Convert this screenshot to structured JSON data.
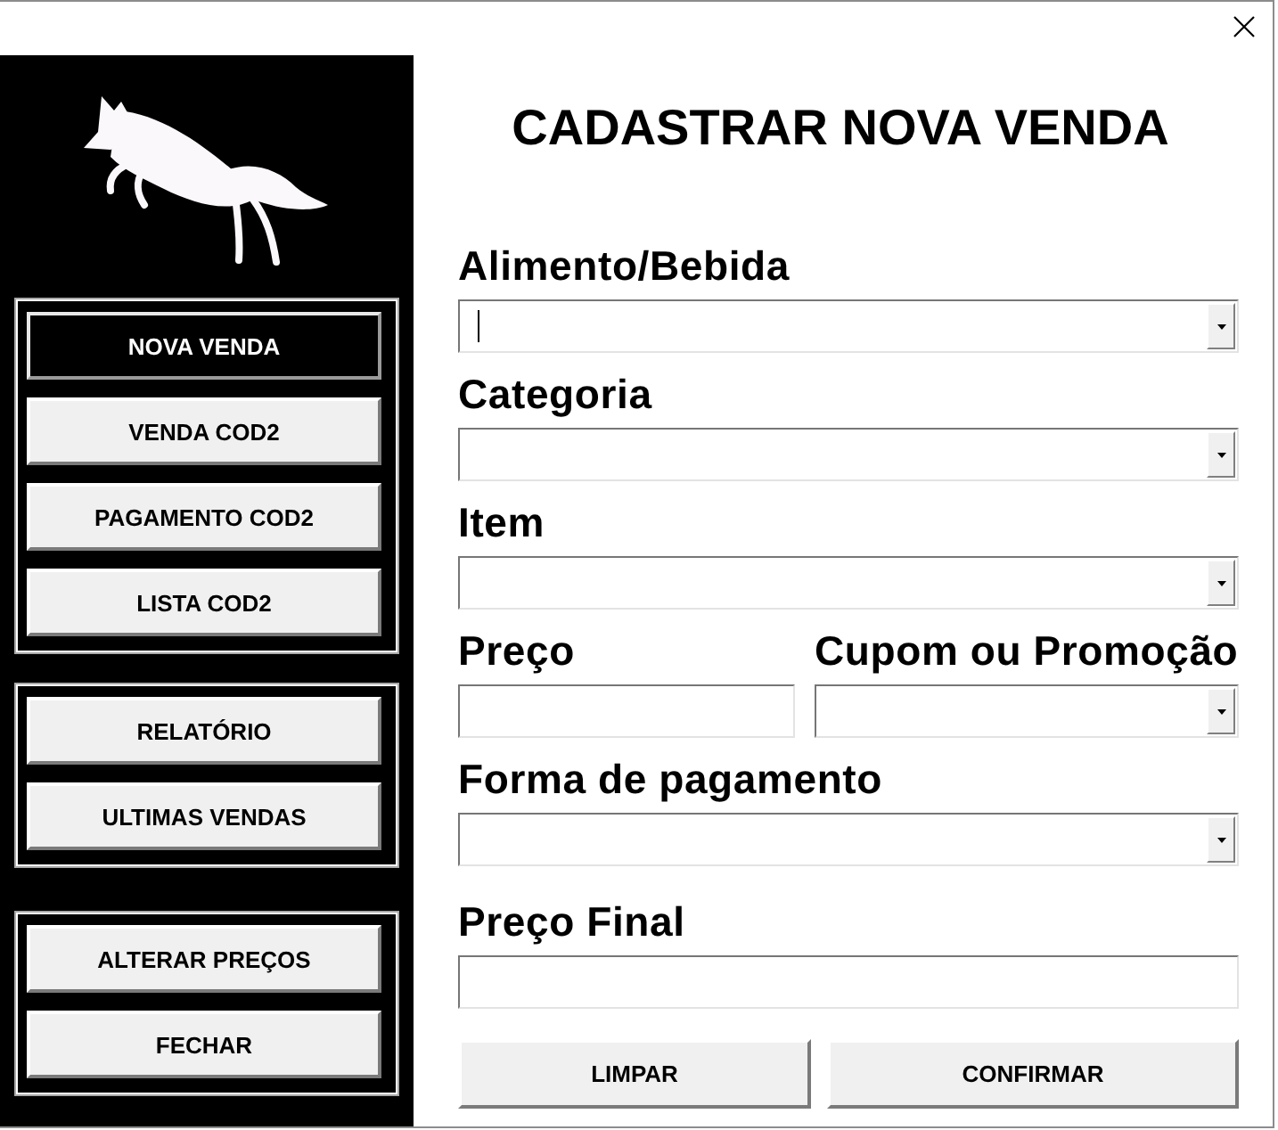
{
  "sidebar": {
    "groups": [
      {
        "buttons": [
          {
            "label": "NOVA VENDA",
            "selected": true
          },
          {
            "label": "VENDA COD2",
            "selected": false
          },
          {
            "label": "PAGAMENTO COD2",
            "selected": false
          },
          {
            "label": "LISTA COD2",
            "selected": false
          }
        ]
      },
      {
        "buttons": [
          {
            "label": "RELATÓRIO",
            "selected": false
          },
          {
            "label": "ULTIMAS VENDAS",
            "selected": false
          }
        ]
      },
      {
        "buttons": [
          {
            "label": "ALTERAR PREÇOS",
            "selected": false
          },
          {
            "label": "FECHAR",
            "selected": false
          }
        ]
      }
    ]
  },
  "form": {
    "title": "CADASTRAR NOVA VENDA",
    "rows": [
      {
        "fields": [
          {
            "label": "Alimento/Bebida",
            "kind": "combo",
            "focused": true
          }
        ]
      },
      {
        "fields": [
          {
            "label": "Categoria",
            "kind": "combo",
            "focused": false
          }
        ]
      },
      {
        "fields": [
          {
            "label": "Item",
            "kind": "combo",
            "focused": false
          }
        ]
      },
      {
        "fields": [
          {
            "label": "Preço",
            "kind": "text",
            "focused": false
          },
          {
            "label": "Cupom ou Promoção",
            "kind": "combo",
            "focused": false
          }
        ]
      },
      {
        "fields": [
          {
            "label": "Forma de pagamento",
            "kind": "combo",
            "focused": false
          }
        ]
      },
      {
        "fields": [
          {
            "label": "Preço Final",
            "kind": "text",
            "focused": false
          }
        ]
      }
    ],
    "buttons": [
      "LIMPAR",
      "CONFIRMAR"
    ]
  }
}
